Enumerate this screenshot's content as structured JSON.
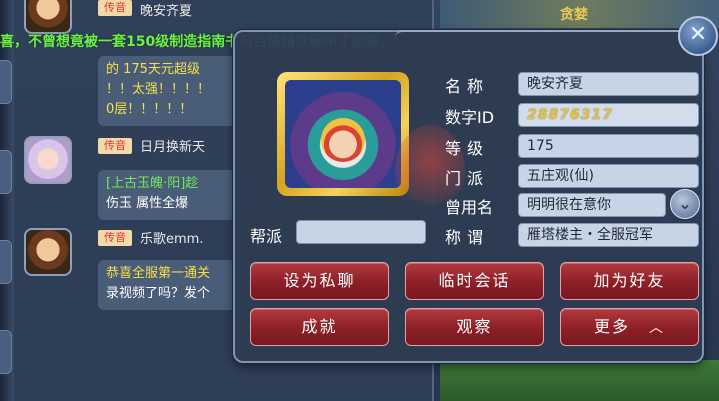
{
  "marquee": {
    "text": "喜，不曾想竟被一套150级制造指南书与百炼精铁砸中了脑袋。"
  },
  "chat": {
    "messages": [
      {
        "tag": "传音",
        "nick": "晚安齐夏",
        "lines": [
          "的   175天元超级",
          "！！太强！！！！",
          "0层！！！！！"
        ]
      },
      {
        "tag": "传音",
        "nick": "日月换新天",
        "lines": [
          "[上古玉魄·阳]趁",
          "伤玉   属性全爆"
        ]
      },
      {
        "tag": "传音",
        "nick": "乐歌emm.",
        "lines": [
          "恭喜全服第一通关",
          "录视频了吗？发个"
        ]
      }
    ]
  },
  "topbar": {
    "gold_text": "贪婪"
  },
  "profile": {
    "labels": {
      "name": "名称",
      "id": "数字ID",
      "level": "等级",
      "school": "门派",
      "former_name": "曾用名",
      "title": "称谓",
      "guild": "帮派"
    },
    "values": {
      "name": "晚安齐夏",
      "id": "28876317",
      "level": "175",
      "school": "五庄观(仙)",
      "former_name": "明明很在意你",
      "title": "雁塔楼主・全服冠军",
      "guild": ""
    },
    "buttons": {
      "set_private": "设为私聊",
      "temp_chat": "临时会话",
      "add_friend": "加为好友",
      "achievement": "成就",
      "observe": "观察",
      "more": "更多"
    },
    "icons": {
      "close": "close-icon",
      "expand": "chevron-down-icon",
      "more_chevron": "chevron-up-icon"
    }
  },
  "colors": {
    "button_red": "#8c1f28",
    "field_bg": "#c7d4e6",
    "id_gold": "#e3c24a",
    "marquee_green": "#6df04a"
  }
}
